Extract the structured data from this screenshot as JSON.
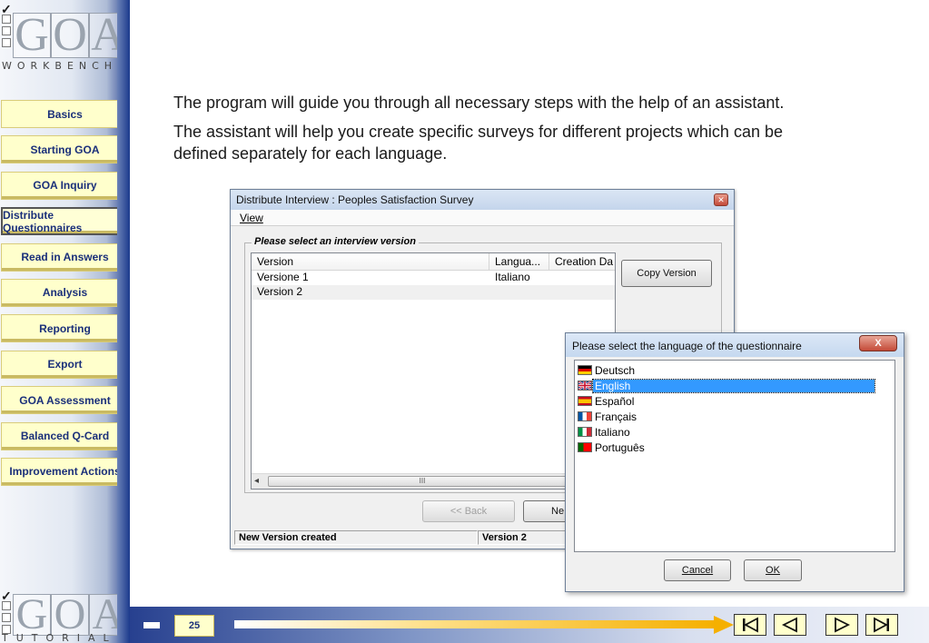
{
  "logo_top": {
    "letters": [
      "G",
      "O",
      "A"
    ],
    "sub": "WORKBENCH"
  },
  "logo_bottom": {
    "letters": [
      "G",
      "O",
      "A"
    ],
    "sub": "TUTORIAL"
  },
  "nav": [
    {
      "label": "Basics"
    },
    {
      "label": "Starting GOA"
    },
    {
      "label": "GOA Inquiry"
    },
    {
      "label": "Distribute Questionnaires",
      "active": true
    },
    {
      "label": "Read in Answers"
    },
    {
      "label": "Analysis"
    },
    {
      "label": "Reporting"
    },
    {
      "label": "Export"
    },
    {
      "label": "GOA Assessment"
    },
    {
      "label": "Balanced Q-Card"
    },
    {
      "label": "Improvement Actions"
    }
  ],
  "content": {
    "para1": "The program will guide you through all necessary steps with the help of an assistant.",
    "para2_line1": "The assistant will help you create specific surveys for different projects which can be",
    "para2_line2": "defined separately for each language."
  },
  "dialog1": {
    "title": "Distribute Interview :  Peoples Satisfaction Survey",
    "menu_view": "View",
    "group_label": "Please select an interview version",
    "columns": [
      "Version",
      "Langua...",
      "Creation Da"
    ],
    "rows": [
      [
        "Versione 1",
        "Italiano",
        ""
      ],
      [
        "Version 2",
        "",
        ""
      ]
    ],
    "scroll_label": "III",
    "copy_button": "Copy Version",
    "back_button": "<< Back",
    "next_button": "Ne",
    "status_left": "New Version created",
    "status_right": "Version 2"
  },
  "dialog2": {
    "title": "Please select the language of the questionnaire",
    "close_glyph": "X",
    "languages": [
      {
        "label": "Deutsch",
        "flag": "de"
      },
      {
        "label": "English",
        "flag": "uk",
        "selected": true
      },
      {
        "label": "Español",
        "flag": "es"
      },
      {
        "label": "Français",
        "flag": "fr"
      },
      {
        "label": "Italiano",
        "flag": "it"
      },
      {
        "label": "Português",
        "flag": "pt"
      }
    ],
    "cancel_button": "Cancel",
    "ok_button": "OK"
  },
  "footer": {
    "page_number": "25"
  },
  "colors": {
    "nav_bg": "#ffffcc",
    "nav_text": "#1a2f7a",
    "selection": "#3399ff",
    "accent": "#f5b000"
  }
}
